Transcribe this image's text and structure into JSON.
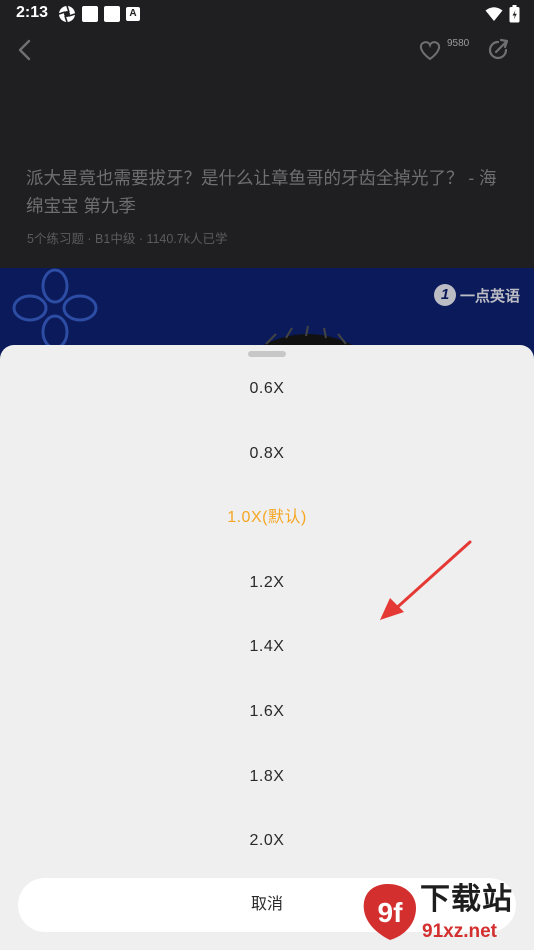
{
  "status_bar": {
    "time": "2:13",
    "notification_badge": "A"
  },
  "header": {
    "like_count": "9580"
  },
  "lesson": {
    "title": "派大星竟也需要拔牙？是什么让章鱼哥的牙齿全掉光了？ - 海绵宝宝 第九季",
    "meta": "5个练习题 · B1中级 · 1140.7k人已学"
  },
  "video": {
    "brand": "一点英语",
    "brand_mark": "1"
  },
  "speed_sheet": {
    "options": [
      {
        "label": "0.6X",
        "selected": false
      },
      {
        "label": "0.8X",
        "selected": false
      },
      {
        "label": "1.0X(默认)",
        "selected": true
      },
      {
        "label": "1.2X",
        "selected": false
      },
      {
        "label": "1.4X",
        "selected": false
      },
      {
        "label": "1.6X",
        "selected": false
      },
      {
        "label": "1.8X",
        "selected": false
      },
      {
        "label": "2.0X",
        "selected": false
      }
    ],
    "cancel_label": "取消"
  },
  "watermark": {
    "mark": "9f",
    "text_cn": "下载站",
    "text_url": "91xz.net"
  },
  "colors": {
    "accent_selected": "#f5a623",
    "annotation_arrow": "#e53935",
    "sheet_background": "#efefef",
    "page_background": "#1f1f21",
    "video_background": "#0a1a5a"
  },
  "icons": [
    "back-arrow-icon",
    "heart-icon",
    "share-icon",
    "wifi-icon",
    "battery-icon",
    "shutter-icon"
  ]
}
